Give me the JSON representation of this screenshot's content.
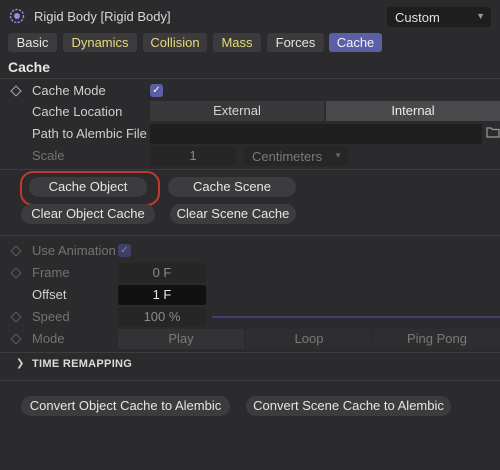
{
  "header": {
    "title": "Rigid Body [Rigid Body]",
    "preset": "Custom",
    "app_icon": "gear-atom-icon",
    "dropdown_icon": "chevron-down-icon"
  },
  "tabs": [
    {
      "label": "Basic",
      "state": "normal"
    },
    {
      "label": "Dynamics",
      "state": "highlight"
    },
    {
      "label": "Collision",
      "state": "highlight"
    },
    {
      "label": "Mass",
      "state": "highlight"
    },
    {
      "label": "Forces",
      "state": "normal"
    },
    {
      "label": "Cache",
      "state": "active"
    }
  ],
  "cache": {
    "section_title": "Cache",
    "mode_label": "Cache Mode",
    "mode_checked": true,
    "location_label": "Cache Location",
    "location_options": [
      "External",
      "Internal"
    ],
    "location_selected": "Internal",
    "path_label": "Path to Alembic File",
    "path_value": "",
    "folder_icon": "folder-icon",
    "scale_label": "Scale",
    "scale_value": "1",
    "scale_unit": "Centimeters",
    "cache_object_btn": "Cache Object",
    "cache_scene_btn": "Cache Scene",
    "clear_object_btn": "Clear Object Cache",
    "clear_scene_btn": "Clear Scene Cache"
  },
  "animation": {
    "use_label": "Use Animation",
    "use_checked": true,
    "frame_label": "Frame",
    "frame_value": "0 F",
    "offset_label": "Offset",
    "offset_value": "1 F",
    "speed_label": "Speed",
    "speed_value": "100 %",
    "speed_level_percent": 100,
    "mode_label": "Mode",
    "mode_options": [
      "Play",
      "Loop",
      "Ping Pong"
    ],
    "mode_selected": "Play"
  },
  "time_remapping": {
    "label": "TIME REMAPPING",
    "expanded": false
  },
  "convert": {
    "object_btn": "Convert Object Cache to Alembic",
    "scene_btn": "Convert Scene Cache to Alembic"
  },
  "colors": {
    "accent": "#5b5fa6",
    "highlight_ring": "#c23a2e",
    "highlight_tab_text": "#e8d97a",
    "background": "#2b2b2d"
  }
}
